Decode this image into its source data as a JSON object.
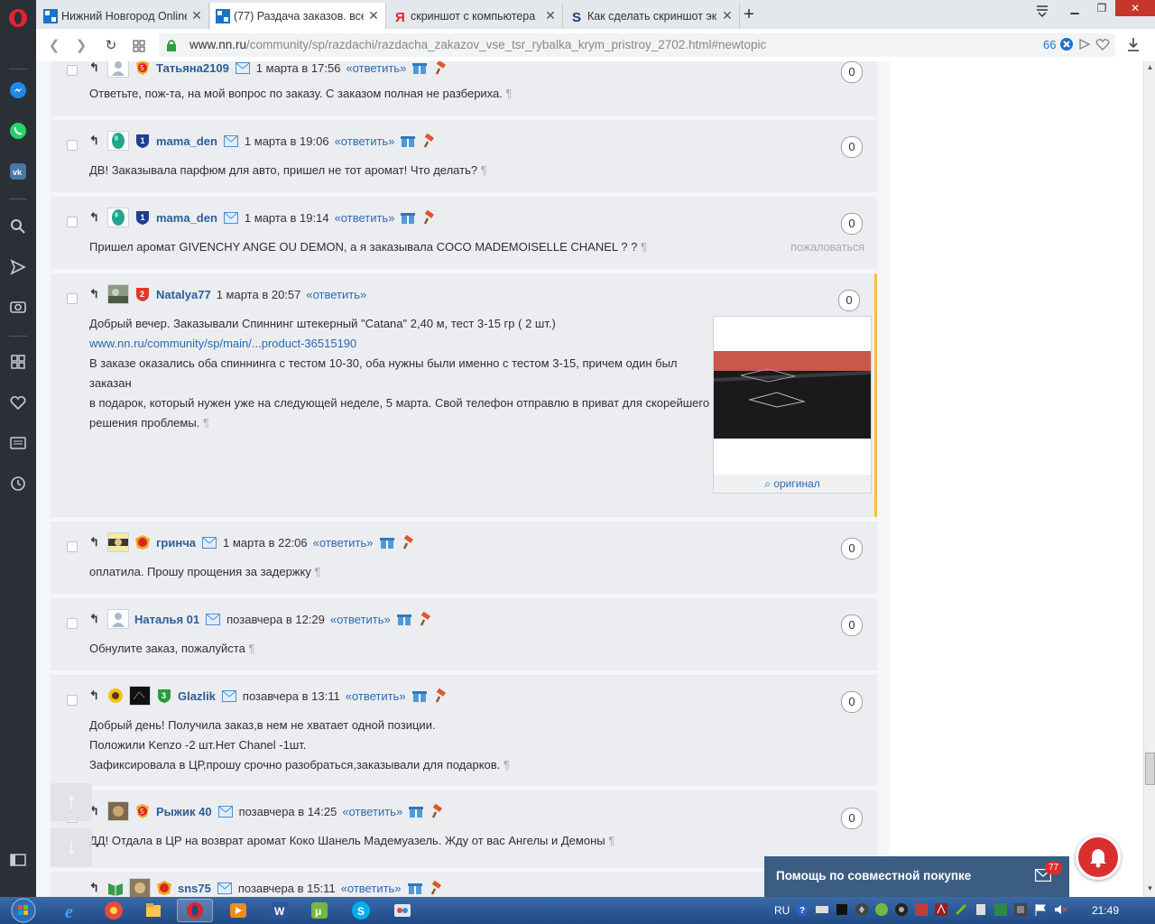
{
  "browser": {
    "tabs": [
      {
        "title": "Нижний Новгород Online",
        "favicon": "nn-logo-icon"
      },
      {
        "title": "(77) Раздача заказов. все",
        "favicon": "nn-logo-icon"
      },
      {
        "title": "скриншот с компьютера",
        "favicon": "yandex-icon"
      },
      {
        "title": "Как сделать скриншот эк",
        "favicon": "s-icon"
      }
    ],
    "url_host": "www.nn.ru",
    "url_path": "/community/sp/razdachi/razdacha_zakazov_vse_tsr_rybalka_krym_pristroy_2702.html#newtopic",
    "blocked_count": "66"
  },
  "comments": [
    {
      "user": "Татьяна2109",
      "date": "1 марта в 17:56",
      "reply": "«ответить»",
      "score": "0",
      "text": [
        "Ответьте, пож-та, на мой вопрос по заказу. С заказом полная не разбериха."
      ]
    },
    {
      "user": "mama_den",
      "date": "1 марта в 19:06",
      "reply": "«ответить»",
      "score": "0",
      "text": [
        "ДВ! Заказывала парфюм для авто, пришел не тот аромат! Что делать?"
      ]
    },
    {
      "user": "mama_den",
      "date": "1 марта в 19:14",
      "reply": "«ответить»",
      "score": "0",
      "text": [
        "Пришел аромат GIVENCHY ANGE OU DEMON, а я заказывала COCO MADEMOISELLE CHANEL ? ?"
      ],
      "complain": "пожаловаться"
    },
    {
      "user": "Natalya77",
      "date": "1 марта в 20:57",
      "reply": "«ответить»",
      "score": "0",
      "text": [
        "Добрый вечер. Заказывали Спиннинг штекерный \"Catana\" 2,40 м, тест 3-15 гр ( 2 шт.)",
        "В заказе оказались оба спиннинга с тестом 10-30, оба нужны были именно с тестом 3-15, причем один был заказан",
        "в подарок, который нужен уже на следующей неделе, 5 марта. Свой телефон отправлю в приват для скорейшего",
        "решения проблемы."
      ],
      "link": "www.nn.ru/community/sp/main/...product-36515190",
      "image_caption": "оригинал"
    },
    {
      "user": "гринча",
      "date": "1 марта в 22:06",
      "reply": "«ответить»",
      "score": "0",
      "text": [
        "оплатила. Прошу прощения за задержку"
      ]
    },
    {
      "user": "Наталья 01",
      "date": "позавчера в 12:29",
      "reply": "«ответить»",
      "score": "0",
      "text": [
        "Обнулите заказ, пожалуйста"
      ]
    },
    {
      "user": "Glazlik",
      "date": "позавчера в 13:11",
      "reply": "«ответить»",
      "score": "0",
      "text": [
        "Добрый день! Получила заказ,в нем не хватает одной позиции.",
        "Положили Kenzo -2 шт.Нет Chanel -1шт.",
        "Зафиксировала в ЦР,прошу срочно разобраться,заказывали для подарков."
      ]
    },
    {
      "user": "Рыжик 40",
      "date": "позавчера в 14:25",
      "reply": "«ответить»",
      "score": "0",
      "text": [
        "ДД! Отдала в ЦР на возврат аромат Коко Шанель Мадемуазель. Жду от вас Ангелы и Демоны"
      ]
    },
    {
      "user": "sns75",
      "date": "позавчера в 15:11",
      "reply": "«ответить»",
      "score": "0",
      "text": []
    }
  ],
  "pilcrow": "¶",
  "badges": {
    "tatyana": "5",
    "mama": "1",
    "natalya": "2",
    "glazlik": "3",
    "ryzhik": "5"
  },
  "help": {
    "title": "Помощь по совместной покупке",
    "count": "77"
  },
  "taskbar": {
    "lang": "RU",
    "time": "21:49"
  },
  "colors": {
    "accent": "#2c69b5",
    "username": "#2c5d98",
    "highlight_border": "#f2c23c",
    "help_bg": "#3c5d82",
    "bell": "#d9302f"
  }
}
